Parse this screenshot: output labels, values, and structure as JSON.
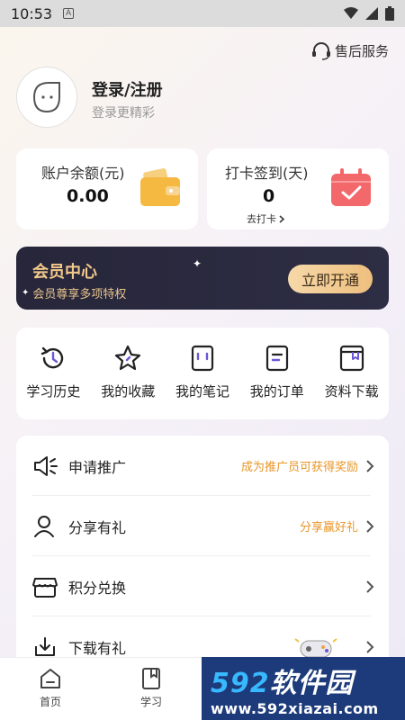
{
  "status_bar": {
    "time": "10:53",
    "badge": "A"
  },
  "header": {
    "after_sale": "售后服务",
    "login_title": "登录/注册",
    "login_sub": "登录更精彩"
  },
  "balance_card": {
    "label": "账户余额(元)",
    "value": "0.00"
  },
  "checkin_card": {
    "label": "打卡签到(天)",
    "value": "0",
    "link": "去打卡"
  },
  "vip": {
    "title": "会员中心",
    "subtitle": "会员尊享多项特权",
    "button": "立即开通"
  },
  "shortcuts": [
    {
      "label": "学习历史",
      "icon": "history-icon"
    },
    {
      "label": "我的收藏",
      "icon": "star-icon"
    },
    {
      "label": "我的笔记",
      "icon": "notebook-icon"
    },
    {
      "label": "我的订单",
      "icon": "order-icon"
    },
    {
      "label": "资料下载",
      "icon": "book-download-icon"
    }
  ],
  "menu": [
    {
      "label": "申请推广",
      "note": "成为推广员可获得奖励",
      "icon": "megaphone-icon"
    },
    {
      "label": "分享有礼",
      "note": "分享赢好礼",
      "icon": "user-icon"
    },
    {
      "label": "积分兑换",
      "note": "",
      "icon": "store-icon"
    },
    {
      "label": "下载有礼",
      "note": "",
      "icon": "download-icon"
    }
  ],
  "bottom_nav": [
    {
      "label": "首页",
      "icon": "home-icon"
    },
    {
      "label": "学习",
      "icon": "study-book-icon"
    }
  ],
  "watermark": {
    "brand_num": "592",
    "brand_text": "软件园",
    "url": "www.592xiazai.com"
  },
  "colors": {
    "accent_orange": "#e7962a",
    "vip_bg": "#27263a",
    "vip_gold": "#f3c98b"
  }
}
